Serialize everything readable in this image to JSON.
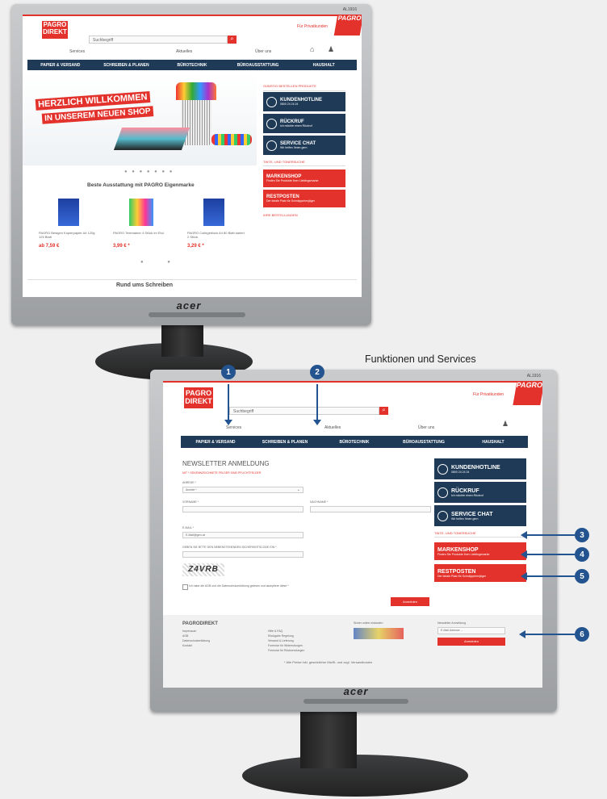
{
  "top": {
    "logo_line1": "PAGRO",
    "logo_line2": "DIREKT",
    "search_placeholder": "Suchbegriff",
    "model": "AL1916",
    "top_link": "Für Privatkunden",
    "corner": "PAGRO",
    "nav_top": [
      "Services",
      "Aktuelles",
      "Über uns"
    ],
    "menu": [
      "PAPIER & VERSAND",
      "SCHREIBEN & PLANEN",
      "BÜROTECHNIK",
      "BÜROAUSSTATTUNG",
      "HAUSHALT"
    ],
    "promo_label": "GÜNSTIG BESTELLEN PRODUKTE",
    "banner_line1": "HERZLICH WILLKOMMEN",
    "banner_line2": "IN UNSEREM NEUEN SHOP",
    "section_title": "Beste Ausstattung mit PAGRO Eigenmarke",
    "products": [
      {
        "name": "PAGRO Bestgen Kopierpapier A4 120g 125 Blatt",
        "price": "ab 7,59 €"
      },
      {
        "name": "PAGRO Textmarker 4 Stück im Etui",
        "price": "3,99 € *"
      },
      {
        "name": "PAGRO Collegeblock A4 80 Blatt kariert 2 Stück",
        "price": "3,29 € *"
      }
    ],
    "bottom_title": "Rund ums Schreiben",
    "side": {
      "hotline": "KUNDENHOTLINE",
      "hotline_sub": "0800 24 24 24",
      "callback": "RÜCKRUF",
      "callback_sub": "Ich möchte einen Rückruf",
      "chat": "SERVICE CHAT",
      "chat_sub": "Wir helfen Ihnen gern",
      "tinte": "TINTE- UND TONERSUCHE",
      "marken": "MARKENSHOP",
      "marken_sub": "Finden Sie Produkte Ihrer Lieblingsmarke",
      "rest": "RESTPOSTEN",
      "rest_sub": "Der ideale Platz für Schnäppchenjäger",
      "order": "IHRE BESTELLUNGEN"
    },
    "monitor_brand": "acer"
  },
  "caption": "Funktionen und Services",
  "bottom": {
    "logo_line1": "PAGRO",
    "logo_line2": "DIREKT",
    "search_placeholder": "Suchbegriff",
    "model": "AL1916",
    "top_link": "Für Privatkunden",
    "corner": "PAGRO",
    "nav_top": [
      "Services",
      "Aktuelles",
      "Über uns"
    ],
    "menu": [
      "PAPIER & VERSAND",
      "SCHREIBEN & PLANEN",
      "BÜROTECHNIK",
      "BÜROAUSSTATTUNG",
      "HAUSHALT"
    ],
    "form_title": "NEWSLETTER ANMELDUNG",
    "form_note": "MIT * GEKENNZEICHNETE FELDER SIND PFLICHTFELDER",
    "anrede_label": "ANREDE *",
    "anrede_value": "Anrede *",
    "vorname_label": "VORNAME *",
    "nachname_label": "NACHNAME *",
    "email_label": "E-MAIL *",
    "email_value": "E-Mail@gmx.at",
    "captcha_label": "GEBEN SIE BITTE DEN NEBENSTEHENDEN SICHERHEITSCODE EIN *",
    "captcha_text": "Z4VRB",
    "agb_text": "Ich habe die AGB und die Datenschutzerklärung gelesen und akzeptiere diese *",
    "submit": "Anmelden",
    "side": {
      "hotline": "KUNDENHOTLINE",
      "hotline_sub": "0800 24 24 24",
      "callback": "RÜCKRUF",
      "callback_sub": "Ich möchte einen Rückruf",
      "chat": "SERVICE CHAT",
      "chat_sub": "Wir helfen Ihnen gern",
      "tinte": "TINTE- UND TONERSUCHE",
      "marken": "MARKENSHOP",
      "marken_sub": "Finden Sie Produkte Ihrer Lieblingsmarke",
      "rest": "RESTPOSTEN",
      "rest_sub": "Der ideale Platz für Schnäppchenjäger"
    },
    "footer": {
      "brand": "PAGRODIREKT",
      "col1": [
        "Impressum",
        "AGB",
        "Datenschutzerklärung",
        "Kontakt"
      ],
      "col2": [
        "Hilfe & FAQ",
        "Rückgabe Regelung",
        "Versand & Lieferung",
        "Formular für Widerrufungen",
        "Formular für Rücksendungen"
      ],
      "col3_title": "Sicher online einkaufen",
      "col4_title": "Newsletter Anmeldung",
      "newsletter_placeholder": "E-Mail Adresse ...",
      "newsletter_button": "Anmelden",
      "disclaimer": "* Alle Preise inkl. gesetzlicher MwSt. und zzgl. Versandkosten"
    },
    "monitor_brand": "acer"
  },
  "callouts": [
    "1",
    "2",
    "3",
    "4",
    "5",
    "6"
  ]
}
